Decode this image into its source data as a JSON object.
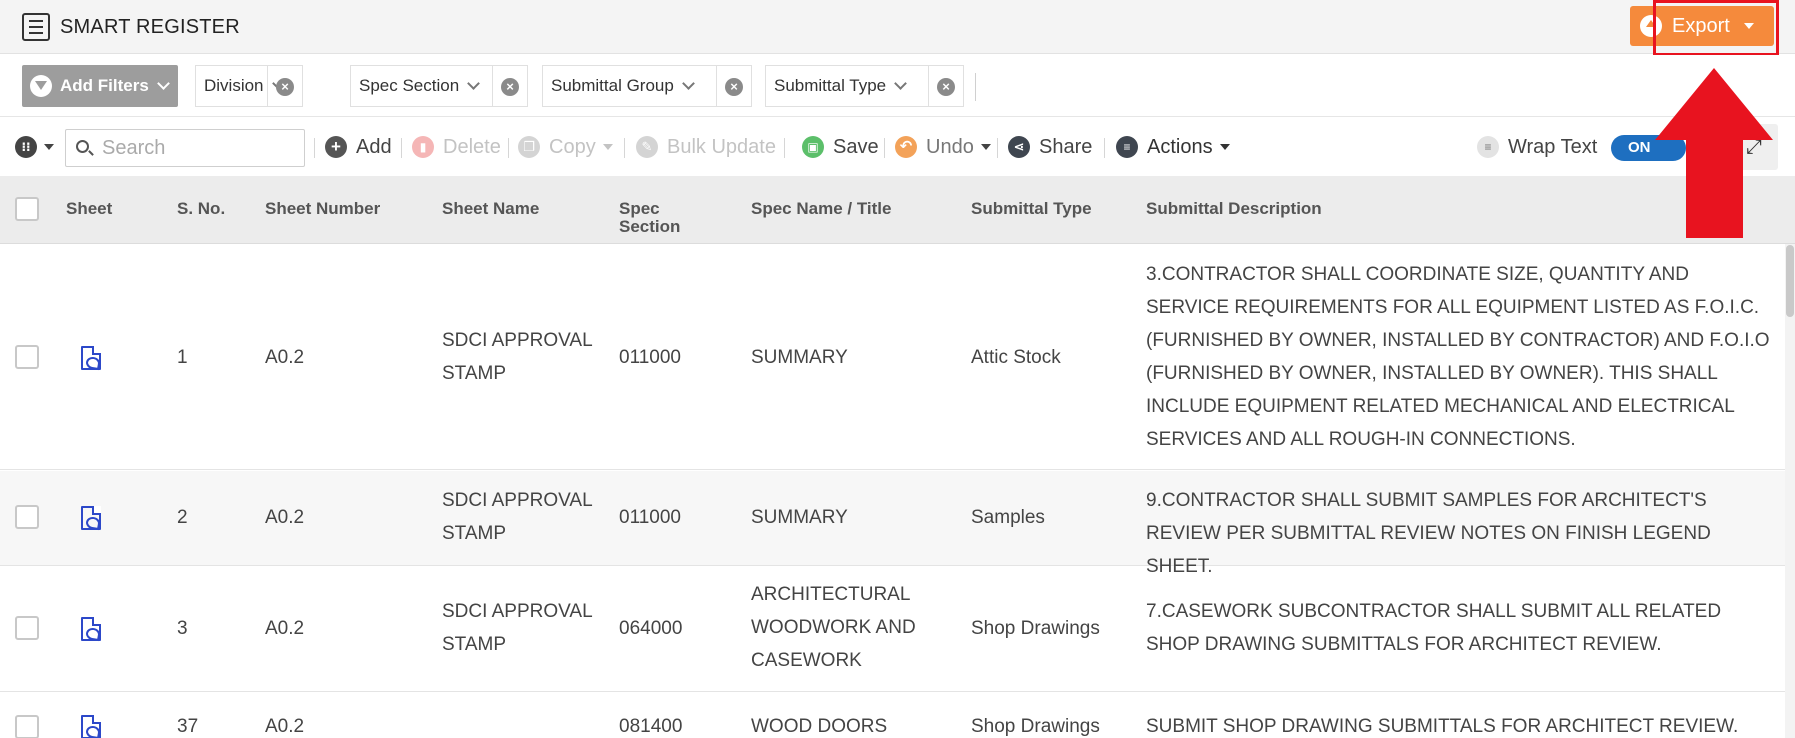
{
  "header": {
    "app_title": "SMART REGISTER",
    "export_label": "Export",
    "icons": {
      "app": "list-icon",
      "export": "cloud-upload-icon"
    }
  },
  "filters": {
    "add_label": "Add Filters",
    "chips": [
      "Division",
      "Spec Section",
      "Submittal Group",
      "Submittal Type"
    ]
  },
  "toolbar": {
    "search_placeholder": "Search",
    "add": "Add",
    "delete": "Delete",
    "copy": "Copy",
    "bulk_update": "Bulk Update",
    "save": "Save",
    "undo": "Undo",
    "share": "Share",
    "actions": "Actions",
    "wrap_text": "Wrap Text",
    "wrap_toggle": "ON"
  },
  "table": {
    "columns": {
      "sheet": "Sheet",
      "sno": "S. No.",
      "sheet_number": "Sheet Number",
      "sheet_name": "Sheet Name",
      "spec_section_1": "Spec",
      "spec_section_2": "Section",
      "spec_name": "Spec Name / Title",
      "submittal_type": "Submittal Type",
      "submittal_description": "Submittal Description"
    },
    "rows": [
      {
        "sno": "1",
        "sheet_number": "A0.2",
        "sheet_name": "SDCI APPROVAL STAMP",
        "spec_section": "011000",
        "spec_name": "SUMMARY",
        "submittal_type": "Attic Stock",
        "description": "3.CONTRACTOR SHALL COORDINATE SIZE, QUANTITY AND SERVICE REQUIREMENTS FOR ALL EQUIPMENT LISTED AS F.O.I.C. (FURNISHED BY OWNER, INSTALLED BY CONTRACTOR) AND F.O.I.O (FURNISHED BY OWNER, INSTALLED BY OWNER). THIS SHALL INCLUDE EQUIPMENT RELATED MECHANICAL AND ELECTRICAL SERVICES AND ALL ROUGH-IN CONNECTIONS."
      },
      {
        "sno": "2",
        "sheet_number": "A0.2",
        "sheet_name": "SDCI APPROVAL STAMP",
        "spec_section": "011000",
        "spec_name": "SUMMARY",
        "submittal_type": "Samples",
        "description": "9.CONTRACTOR SHALL SUBMIT SAMPLES FOR ARCHITECT'S REVIEW PER SUBMITTAL REVIEW NOTES ON FINISH LEGEND SHEET."
      },
      {
        "sno": "3",
        "sheet_number": "A0.2",
        "sheet_name": "SDCI APPROVAL STAMP",
        "spec_section": "064000",
        "spec_name": "ARCHITECTURAL WOODWORK AND CASEWORK",
        "submittal_type": "Shop Drawings",
        "description": "7.CASEWORK SUBCONTRACTOR SHALL SUBMIT ALL RELATED SHOP DRAWING SUBMITTALS FOR ARCHITECT REVIEW."
      },
      {
        "sno": "37",
        "sheet_number": "A0.2",
        "sheet_name": "",
        "spec_section": "081400",
        "spec_name": "WOOD DOORS",
        "submittal_type": "Shop Drawings",
        "description": "SUBMIT SHOP DRAWING SUBMITTALS FOR ARCHITECT REVIEW."
      }
    ]
  },
  "colors": {
    "export": "#f58a3c",
    "highlight": "#e8131f",
    "toggle": "#1e6fc0",
    "pdf_icon": "#2c48c9"
  }
}
